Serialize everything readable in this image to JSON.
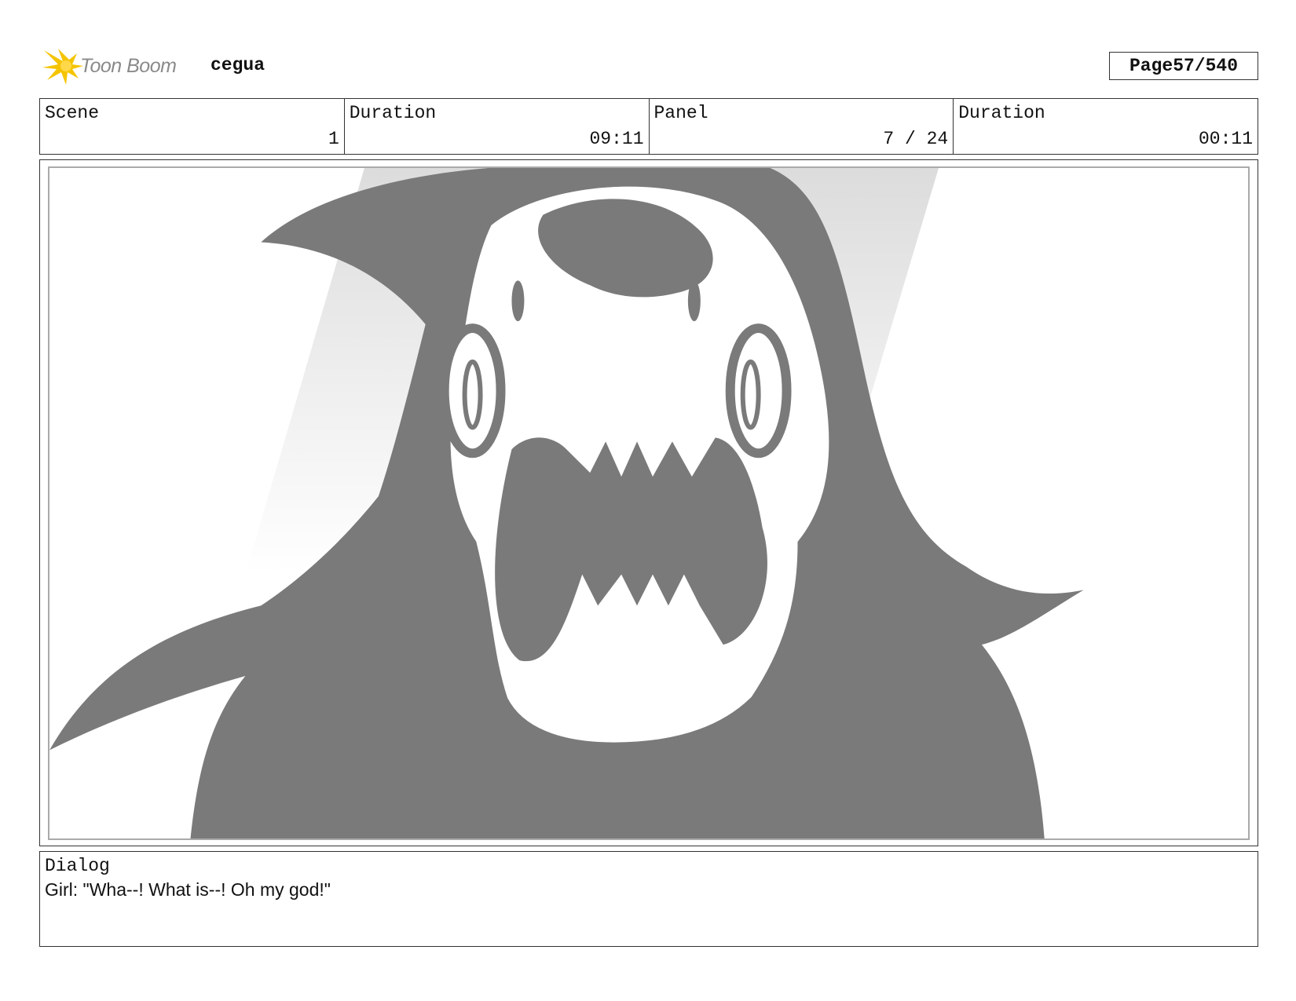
{
  "header": {
    "logo_text": "Toon Boom",
    "logo_icon": "starburst-logo-icon",
    "project": "cegua",
    "page_label": "Page",
    "page_value": "57/540"
  },
  "info": {
    "scene_label": "Scene",
    "scene_value": "1",
    "scene_duration_label": "Duration",
    "scene_duration_value": "09:11",
    "panel_label": "Panel",
    "panel_value": "7 / 24",
    "panel_duration_label": "Duration",
    "panel_duration_value": "00:11"
  },
  "panel": {
    "fill_color": "#7a7a7a",
    "light_color": "#e2e2e2",
    "border_color": "#aaaaaa"
  },
  "dialog": {
    "label": "Dialog",
    "text": "Girl: \"Wha--! What is--! Oh my god!\""
  }
}
